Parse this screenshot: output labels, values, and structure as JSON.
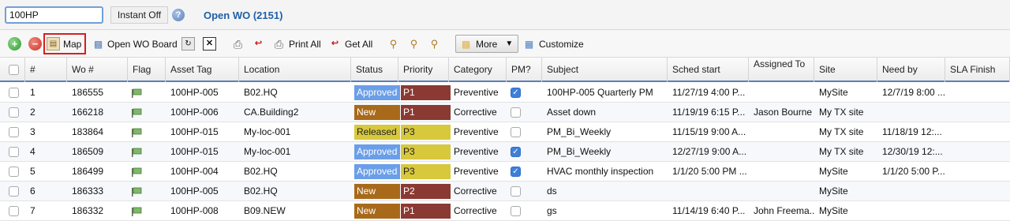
{
  "topbar": {
    "search_value": "100HP",
    "instant_label": "Instant Off",
    "help_glyph": "?",
    "title": "Open WO (2151)"
  },
  "toolbar": {
    "add_glyph": "+",
    "remove_glyph": "−",
    "map_label": "Map",
    "open_wo_board_label": "Open WO Board",
    "print_all_label": "Print All",
    "get_all_label": "Get All",
    "more_label": "More",
    "customize_label": "Customize"
  },
  "columns": [
    "#",
    "Wo #",
    "Flag",
    "Asset Tag",
    "Location",
    "Status",
    "Priority",
    "Category",
    "PM?",
    "Subject",
    "Sched start",
    "Assigned To",
    "Site",
    "Need by",
    "SLA Finish"
  ],
  "colors": {
    "status_approved": "#6b9ee8",
    "status_new": "#a86a1a",
    "status_released": "#d8c83c",
    "prio_p1": "#8a3a32",
    "prio_p2": "#8a3a32",
    "prio_p3": "#d8c83c",
    "header_rule": "#5a7fb8"
  },
  "rows": [
    {
      "num": "1",
      "wo": "186555",
      "asset": "100HP-005",
      "location": "B02.HQ",
      "status": "Approved",
      "status_color": "#6b9ee8",
      "priority": "P1",
      "prio_color": "#8a3a32",
      "category": "Preventive",
      "pm": true,
      "subject": "100HP-005 Quarterly PM",
      "sched": "11/27/19 4:00 P...",
      "assigned": "",
      "site": "MySite",
      "needby": "12/7/19 8:00 ..."
    },
    {
      "num": "2",
      "wo": "166218",
      "asset": "100HP-006",
      "location": "CA.Building2",
      "status": "New",
      "status_color": "#a86a1a",
      "priority": "P1",
      "prio_color": "#8a3a32",
      "category": "Corrective",
      "pm": false,
      "subject": "Asset down",
      "sched": "11/19/19 6:15 P...",
      "assigned": "Jason Bourne",
      "site": "My TX site",
      "needby": ""
    },
    {
      "num": "3",
      "wo": "183864",
      "asset": "100HP-015",
      "location": "My-loc-001",
      "status": "Released",
      "status_color": "#d8c83c",
      "priority": "P3",
      "prio_color": "#d8c83c",
      "category": "Preventive",
      "pm": false,
      "subject": "PM_Bi_Weekly",
      "sched": "11/15/19 9:00 A...",
      "assigned": "",
      "site": "My TX site",
      "needby": "11/18/19 12:..."
    },
    {
      "num": "4",
      "wo": "186509",
      "asset": "100HP-015",
      "location": "My-loc-001",
      "status": "Approved",
      "status_color": "#6b9ee8",
      "priority": "P3",
      "prio_color": "#d8c83c",
      "category": "Preventive",
      "pm": true,
      "subject": "PM_Bi_Weekly",
      "sched": "12/27/19 9:00 A...",
      "assigned": "",
      "site": "My TX site",
      "needby": "12/30/19 12:..."
    },
    {
      "num": "5",
      "wo": "186499",
      "asset": "100HP-004",
      "location": "B02.HQ",
      "status": "Approved",
      "status_color": "#6b9ee8",
      "priority": "P3",
      "prio_color": "#d8c83c",
      "category": "Preventive",
      "pm": true,
      "subject": "HVAC monthly inspection",
      "sched": "1/1/20 5:00 PM ...",
      "assigned": "",
      "site": "MySite",
      "needby": "1/1/20 5:00 P..."
    },
    {
      "num": "6",
      "wo": "186333",
      "asset": "100HP-005",
      "location": "B02.HQ",
      "status": "New",
      "status_color": "#a86a1a",
      "priority": "P2",
      "prio_color": "#8a3a32",
      "category": "Corrective",
      "pm": false,
      "subject": "ds",
      "sched": "",
      "assigned": "",
      "site": "MySite",
      "needby": ""
    },
    {
      "num": "7",
      "wo": "186332",
      "asset": "100HP-008",
      "location": "B09.NEW",
      "status": "New",
      "status_color": "#a86a1a",
      "priority": "P1",
      "prio_color": "#8a3a32",
      "category": "Corrective",
      "pm": false,
      "subject": "gs",
      "sched": "11/14/19 6:40 P...",
      "assigned": "John Freema...",
      "site": "MySite",
      "needby": ""
    }
  ]
}
